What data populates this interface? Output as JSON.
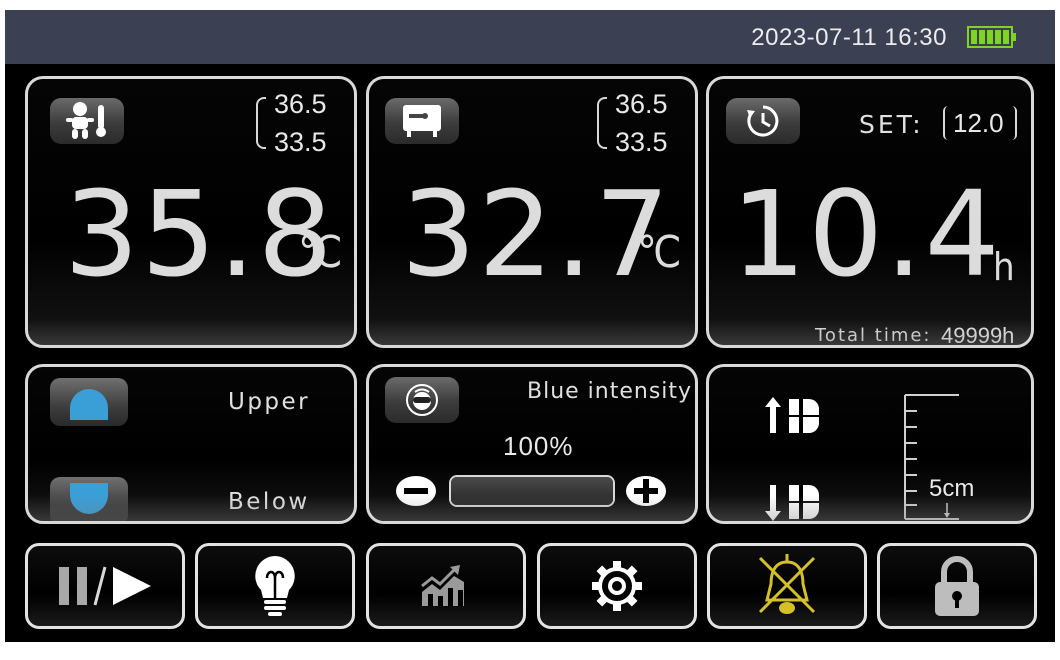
{
  "status_bar": {
    "datetime": "2023-07-11 16:30",
    "battery_icon": "battery-full-icon",
    "battery_color": "#7fd321"
  },
  "skin_temp": {
    "icon": "baby-thermometer-icon",
    "upper": "36.5",
    "lower": "33.5",
    "value": "35.8",
    "unit": "℃"
  },
  "incubator_temp": {
    "icon": "incubator-icon",
    "upper": "36.5",
    "lower": "33.5",
    "value": "32.7",
    "unit": "℃"
  },
  "timer": {
    "icon": "clock-icon",
    "set_label": "SET:",
    "set_value": "12.0",
    "value": "10.4",
    "unit": "h",
    "total_label": "Total time:",
    "total_value": "49999h"
  },
  "lamp_position": {
    "upper_label": "Upper",
    "below_label": "Below",
    "upper_icon": "upper-lamp-icon",
    "below_icon": "lower-lamp-icon",
    "lamp_color": "#3a9fd6"
  },
  "blue_intensity": {
    "icon": "infant-goggles-icon",
    "title": "Blue intensity",
    "value": "100%",
    "level": 1.0,
    "decrease_icon": "minus-icon",
    "increase_icon": "plus-icon"
  },
  "height_adjust": {
    "up_icon": "raise-bed-icon",
    "down_icon": "lower-bed-icon",
    "scale_label": "5cm"
  },
  "toolbar": {
    "buttons": [
      {
        "icon": "pause-play-icon"
      },
      {
        "icon": "light-bulb-icon"
      },
      {
        "icon": "trend-chart-icon"
      },
      {
        "icon": "settings-gear-icon"
      },
      {
        "icon": "alarm-muted-icon",
        "color": "#d4c02a"
      },
      {
        "icon": "lock-icon"
      }
    ]
  }
}
